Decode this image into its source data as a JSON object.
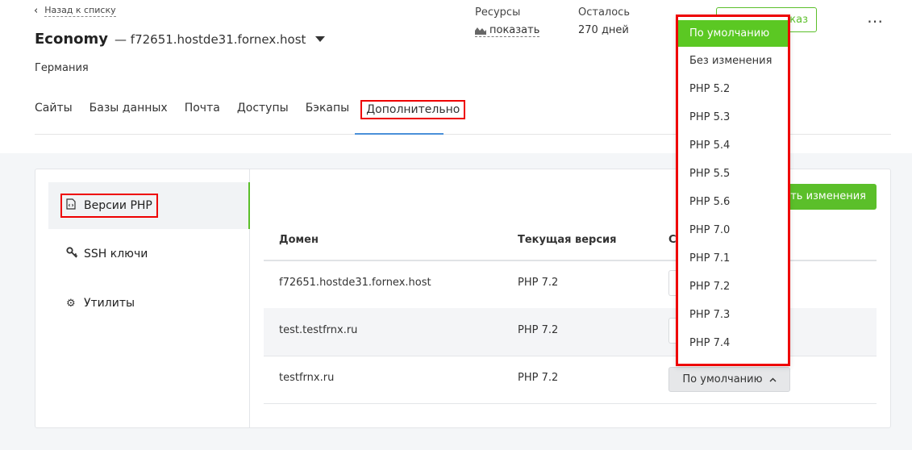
{
  "header": {
    "back_label": "Назад к списку",
    "plan": "Economy",
    "host": "— f72651.hostde31.fornex.host",
    "country": "Германия",
    "resources_label": "Ресурсы",
    "resources_link": "показать",
    "left_label": "Осталось",
    "left_value": "270 дней",
    "order_button": "Заказ"
  },
  "tabs": [
    {
      "label": "Сайты"
    },
    {
      "label": "Базы данных"
    },
    {
      "label": "Почта"
    },
    {
      "label": "Доступы"
    },
    {
      "label": "Бэкапы"
    },
    {
      "label": "Дополнительно"
    }
  ],
  "sidebar": {
    "items": [
      {
        "label": "Версии PHP",
        "icon": "php-file-icon"
      },
      {
        "label": "SSH ключи",
        "icon": "key-icon"
      },
      {
        "label": "Утилиты",
        "icon": "gear-icon"
      }
    ]
  },
  "save_button": "ить изменения",
  "table": {
    "columns": [
      "Домен",
      "Текущая версия",
      "С"
    ],
    "rows": [
      {
        "domain": "f72651.hostde31.fornex.host",
        "version": "PHP 7.2"
      },
      {
        "domain": "test.testfrnx.ru",
        "version": "PHP 7.2"
      },
      {
        "domain": "testfrnx.ru",
        "version": "PHP 7.2",
        "select": "По умолчанию"
      }
    ]
  },
  "dropdown": {
    "options": [
      "По умолчанию",
      "Без изменения",
      "PHP 5.2",
      "PHP 5.3",
      "PHP 5.4",
      "PHP 5.5",
      "PHP 5.6",
      "PHP 7.0",
      "PHP 7.1",
      "PHP 7.2",
      "PHP 7.3",
      "PHP 7.4"
    ],
    "selected": "По умолчанию"
  },
  "colors": {
    "accent": "#5bbf2a",
    "highlight": "#e00000",
    "tab_underline": "#4a90d9"
  }
}
